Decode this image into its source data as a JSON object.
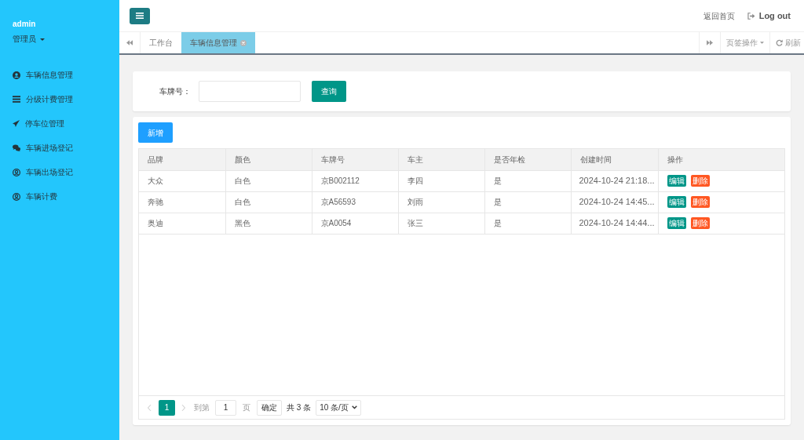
{
  "sidebar": {
    "user": "admin",
    "role": "管理员",
    "items": [
      {
        "label": "车辆信息管理"
      },
      {
        "label": "分级计费管理"
      },
      {
        "label": "停车位管理"
      },
      {
        "label": "车辆进场登记"
      },
      {
        "label": "车辆出场登记"
      },
      {
        "label": "车辆计费"
      }
    ]
  },
  "header": {
    "links": [
      {
        "label": "返回首页",
        "kind": "home"
      },
      {
        "label": "Log out",
        "kind": "logout"
      }
    ]
  },
  "tabs_bar": {
    "tabs": [
      {
        "label": "工作台",
        "selected": false,
        "closable": false
      },
      {
        "label": "车辆信息管理",
        "selected": true,
        "closable": true
      }
    ],
    "tab_actions": "页签操作",
    "refresh": "刷新"
  },
  "search": {
    "label": "车牌号：",
    "button": "查询"
  },
  "toolbar": {
    "add_button": "新增"
  },
  "table": {
    "columns": [
      "品牌",
      "颜色",
      "车牌号",
      "车主",
      "是否年检",
      "创建时间",
      "操作"
    ],
    "rows": [
      {
        "cells": [
          "大众",
          "白色",
          "京B002112",
          "李四",
          "是",
          "2024-10-24 21:18..."
        ],
        "actions": [
          {
            "label": "编辑",
            "kind": "edit"
          },
          {
            "label": "删除",
            "kind": "delete"
          }
        ]
      },
      {
        "cells": [
          "奔驰",
          "白色",
          "京A56593",
          "刘雨",
          "是",
          "2024-10-24 14:45..."
        ],
        "actions": [
          {
            "label": "编辑",
            "kind": "edit"
          },
          {
            "label": "删除",
            "kind": "delete"
          }
        ]
      },
      {
        "cells": [
          "奥迪",
          "黑色",
          "京A0054",
          "张三",
          "是",
          "2024-10-24 14:44..."
        ],
        "actions": [
          {
            "label": "编辑",
            "kind": "edit"
          },
          {
            "label": "删除",
            "kind": "delete"
          }
        ]
      }
    ]
  },
  "pagination": {
    "pages": [
      {
        "label": "1",
        "selected": true
      }
    ],
    "goto_label": "到第",
    "goto_value": "1",
    "page_label": "页",
    "confirm_button": "确定",
    "total": "共 3 条",
    "page_size": "10 条/页"
  }
}
